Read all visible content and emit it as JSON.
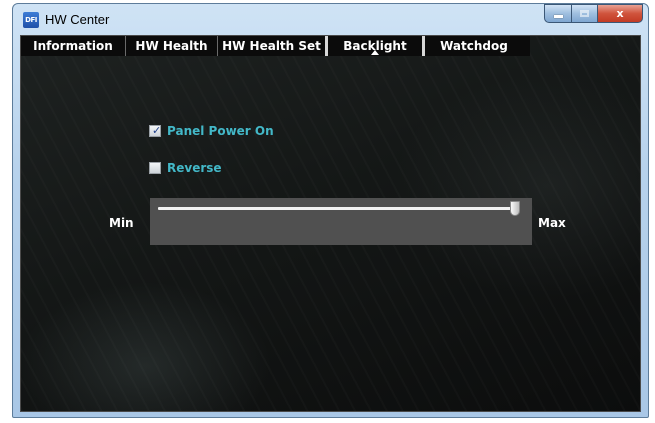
{
  "window": {
    "title": "HW Center",
    "app_icon_text": "DFI",
    "controls": {
      "minimize": "–",
      "maximize": "□",
      "close": "x"
    }
  },
  "tabs": [
    {
      "label": "Information",
      "active": false
    },
    {
      "label": "HW Health",
      "active": false
    },
    {
      "label": "HW Health Set",
      "active": false
    },
    {
      "label": "Backlight",
      "active": true
    },
    {
      "label": "Watchdog",
      "active": false
    }
  ],
  "backlight": {
    "panel_power": {
      "label": "Panel Power On",
      "checked": true,
      "check_glyph": "✓"
    },
    "reverse": {
      "label": "Reverse",
      "checked": false,
      "check_glyph": ""
    },
    "slider": {
      "min_label": "Min",
      "max_label": "Max",
      "value_fraction": 1.0
    }
  },
  "colors": {
    "accent_text": "#43b8c8",
    "background": "#121414",
    "slider_panel": "#505050"
  }
}
